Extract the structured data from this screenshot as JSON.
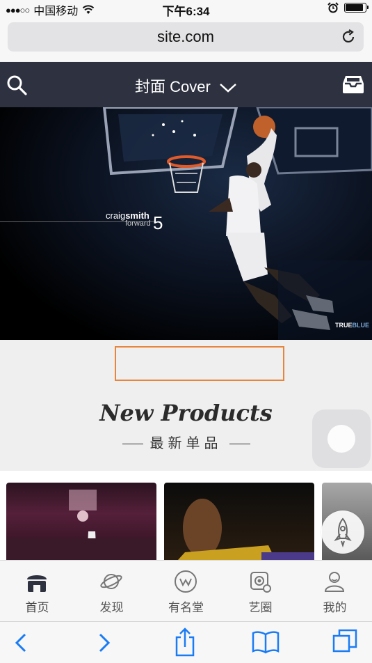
{
  "status_bar": {
    "carrier": "中国移动",
    "signal": "●●●○○",
    "time": "下午6:34",
    "battery_level": 0.9
  },
  "browser": {
    "url": "site.com",
    "reload_icon": "reload-icon"
  },
  "app_header": {
    "title": "封面 Cover",
    "search_icon": "search-icon",
    "inbox_icon": "inbox-icon"
  },
  "hero": {
    "caption_first": "craig",
    "caption_last": "smith",
    "caption_position": "forward",
    "caption_number": "5",
    "watermark_a": "TRUE",
    "watermark_b": "BLUE"
  },
  "section": {
    "title": "New Products",
    "subtitle": "最新单品"
  },
  "tabs": [
    {
      "label": "首页",
      "icon": "home-icon"
    },
    {
      "label": "发现",
      "icon": "planet-icon"
    },
    {
      "label": "有名堂",
      "icon": "w-badge-icon"
    },
    {
      "label": "艺圈",
      "icon": "art-circle-icon"
    },
    {
      "label": "我的",
      "icon": "user-icon"
    }
  ],
  "colors": {
    "header_bg": "#2e3240",
    "highlight_border": "#e8843c",
    "ios_blue": "#1a7cf5"
  }
}
